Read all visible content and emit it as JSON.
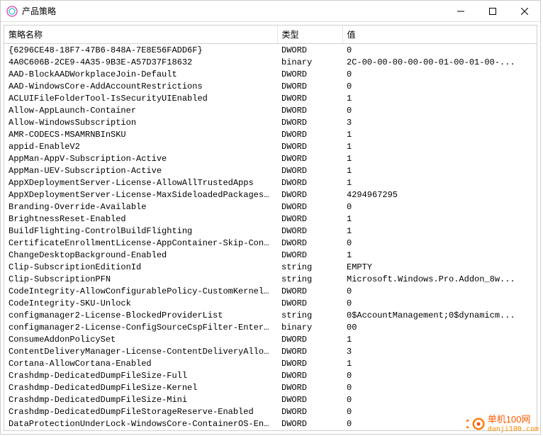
{
  "window": {
    "title": "产品策略"
  },
  "columns": {
    "name": "策略名称",
    "type": "类型",
    "value": "值"
  },
  "rows": [
    {
      "name": "{6296CE48-18F7-47B6-848A-7E8E56FADD6F}",
      "type": "DWORD",
      "value": "0"
    },
    {
      "name": "4A0C606B-2CE9-4A35-9B3E-A57D37F18632",
      "type": "binary",
      "value": "2C-00-00-00-00-00-01-00-01-00-..."
    },
    {
      "name": "AAD-BlockAADWorkplaceJoin-Default",
      "type": "DWORD",
      "value": "0"
    },
    {
      "name": "AAD-WindowsCore-AddAccountRestrictions",
      "type": "DWORD",
      "value": "0"
    },
    {
      "name": "ACLUIFileFolderTool-IsSecurityUIEnabled",
      "type": "DWORD",
      "value": "1"
    },
    {
      "name": "Allow-AppLaunch-Container",
      "type": "DWORD",
      "value": "0"
    },
    {
      "name": "Allow-WindowsSubscription",
      "type": "DWORD",
      "value": "3"
    },
    {
      "name": "AMR-CODECS-MSAMRNBInSKU",
      "type": "DWORD",
      "value": "1"
    },
    {
      "name": "appid-EnableV2",
      "type": "DWORD",
      "value": "1"
    },
    {
      "name": "AppMan-AppV-Subscription-Active",
      "type": "DWORD",
      "value": "1"
    },
    {
      "name": "AppMan-UEV-Subscription-Active",
      "type": "DWORD",
      "value": "1"
    },
    {
      "name": "AppXDeploymentServer-License-AllowAllTrustedApps",
      "type": "DWORD",
      "value": "1"
    },
    {
      "name": "AppXDeploymentServer-License-MaxSideloadedPackages...",
      "type": "DWORD",
      "value": "4294967295"
    },
    {
      "name": "Branding-Override-Available",
      "type": "DWORD",
      "value": "0"
    },
    {
      "name": "BrightnessReset-Enabled",
      "type": "DWORD",
      "value": "1"
    },
    {
      "name": "BuildFlighting-ControlBuildFlighting",
      "type": "DWORD",
      "value": "1"
    },
    {
      "name": "CertificateEnrollmentLicense-AppContainer-Skip-Con...",
      "type": "DWORD",
      "value": "0"
    },
    {
      "name": "ChangeDesktopBackground-Enabled",
      "type": "DWORD",
      "value": "1"
    },
    {
      "name": "Clip-SubscriptionEditionId",
      "type": "string",
      "value": "EMPTY"
    },
    {
      "name": "Clip-SubscriptionPFN",
      "type": "string",
      "value": "Microsoft.Windows.Pro.Addon_8w..."
    },
    {
      "name": "CodeIntegrity-AllowConfigurablePolicy-CustomKernel...",
      "type": "DWORD",
      "value": "0"
    },
    {
      "name": "CodeIntegrity-SKU-Unlock",
      "type": "DWORD",
      "value": "0"
    },
    {
      "name": "configmanager2-License-BlockedProviderList",
      "type": "string",
      "value": "0$AccountManagement;0$dynamicm..."
    },
    {
      "name": "configmanager2-License-ConfigSourceCspFilter-Enter...",
      "type": "binary",
      "value": "00"
    },
    {
      "name": "ConsumeAddonPolicySet",
      "type": "DWORD",
      "value": "1"
    },
    {
      "name": "ContentDeliveryManager-License-ContentDeliveryAllowed",
      "type": "DWORD",
      "value": "3"
    },
    {
      "name": "Cortana-AllowCortana-Enabled",
      "type": "DWORD",
      "value": "1"
    },
    {
      "name": "Crashdmp-DedicatedDumpFileSize-Full",
      "type": "DWORD",
      "value": "0"
    },
    {
      "name": "Crashdmp-DedicatedDumpFileSize-Kernel",
      "type": "DWORD",
      "value": "0"
    },
    {
      "name": "Crashdmp-DedicatedDumpFileSize-Mini",
      "type": "DWORD",
      "value": "0"
    },
    {
      "name": "Crashdmp-DedicatedDumpFileStorageReserve-Enabled",
      "type": "DWORD",
      "value": "0"
    },
    {
      "name": "DataProtectionUnderLock-WindowsCore-ContainerOS-En...",
      "type": "DWORD",
      "value": "0"
    }
  ],
  "watermark": {
    "main": "单机100网",
    "sub": "danji100.com"
  }
}
